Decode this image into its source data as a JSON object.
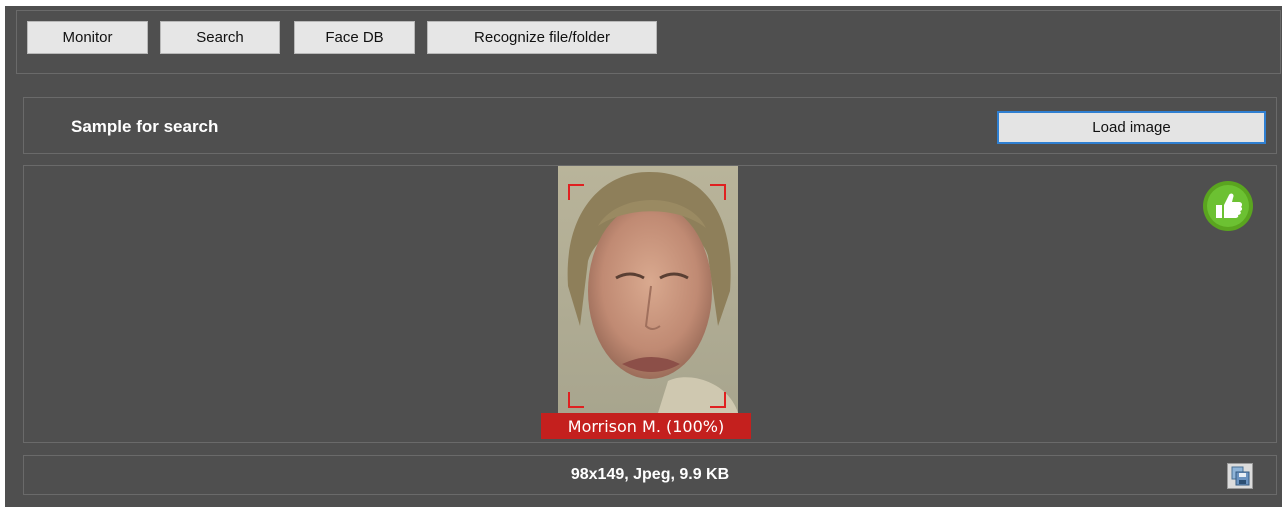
{
  "toolbar": {
    "tabs": [
      {
        "label": "Monitor"
      },
      {
        "label": "Search"
      },
      {
        "label": "Face DB"
      },
      {
        "label": "Recognize file/folder"
      }
    ]
  },
  "sample": {
    "title": "Sample for search",
    "load_button": "Load image"
  },
  "face": {
    "label": "Morrison M. (100%)",
    "overlay_color": "#c4201e",
    "frame_color": "#e02020"
  },
  "status": {
    "info": "98x149, Jpeg, 9.9 KB"
  },
  "icons": {
    "approve": "thumbs-up-icon",
    "save": "save-icon"
  },
  "colors": {
    "background": "#4f4f4f",
    "accent": "#2f7fd1",
    "approve_green": "#6cc132"
  }
}
